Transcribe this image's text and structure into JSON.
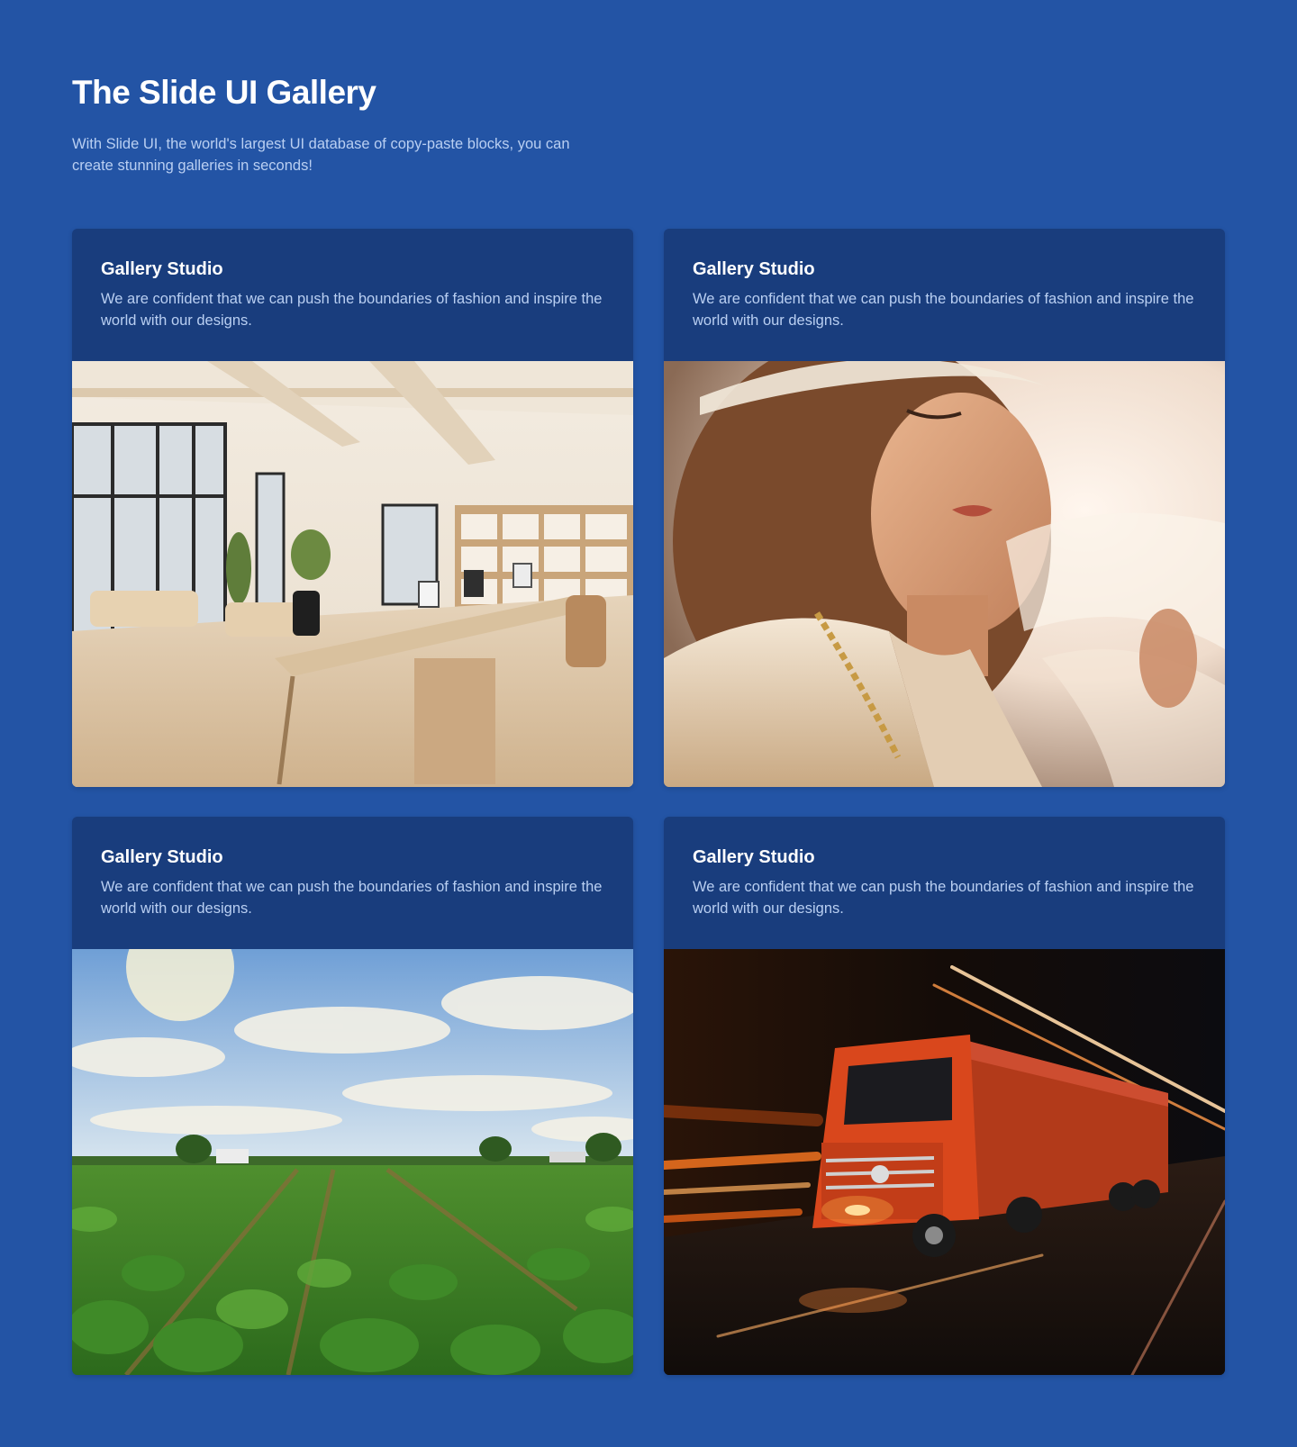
{
  "header": {
    "title": "The Slide UI Gallery",
    "subtitle": "With Slide UI, the world's largest UI database of copy-paste blocks, you can create stunning galleries in seconds!"
  },
  "cards": [
    {
      "title": "Gallery Studio",
      "text": "We are confident that we can push the boundaries of fashion and inspire the world with our designs.",
      "image": "office-interior-photo"
    },
    {
      "title": "Gallery Studio",
      "text": "We are confident that we can push the boundaries of fashion and inspire the world with our designs.",
      "image": "fashion-portrait-photo"
    },
    {
      "title": "Gallery Studio",
      "text": "We are confident that we can push the boundaries of fashion and inspire the world with our designs.",
      "image": "crop-field-photo"
    },
    {
      "title": "Gallery Studio",
      "text": "We are confident that we can push the boundaries of fashion and inspire the world with our designs.",
      "image": "truck-photo"
    }
  ],
  "colors": {
    "background": "#2354a5",
    "card": "#193d7d",
    "text_muted": "#b9cff2",
    "title": "#ffffff"
  }
}
